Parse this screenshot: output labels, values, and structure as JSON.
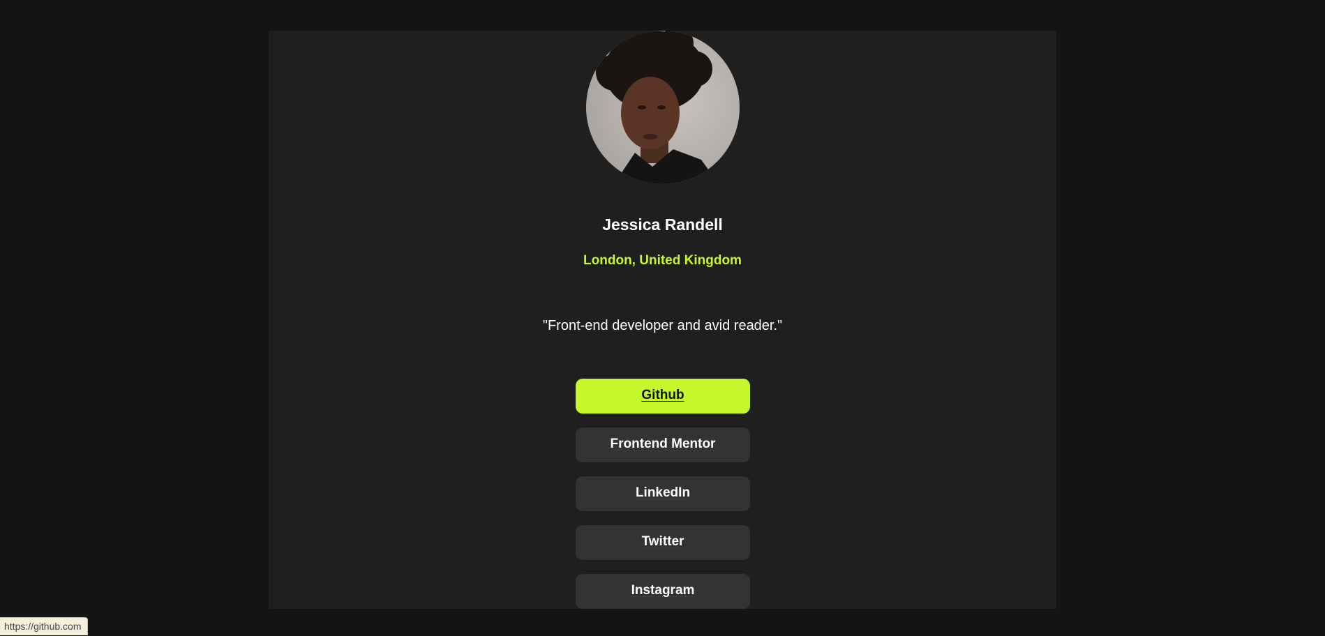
{
  "profile": {
    "name": "Jessica Randell",
    "location": "London, United Kingdom",
    "bio": "\"Front-end developer and avid reader.\"",
    "accent_color": "#c4f82a"
  },
  "links": [
    {
      "label": "Github",
      "state": "hover"
    },
    {
      "label": "Frontend Mentor",
      "state": "default"
    },
    {
      "label": "LinkedIn",
      "state": "default"
    },
    {
      "label": "Twitter",
      "state": "default"
    },
    {
      "label": "Instagram",
      "state": "default"
    }
  ],
  "status_bar": {
    "url": "https://github.com"
  }
}
